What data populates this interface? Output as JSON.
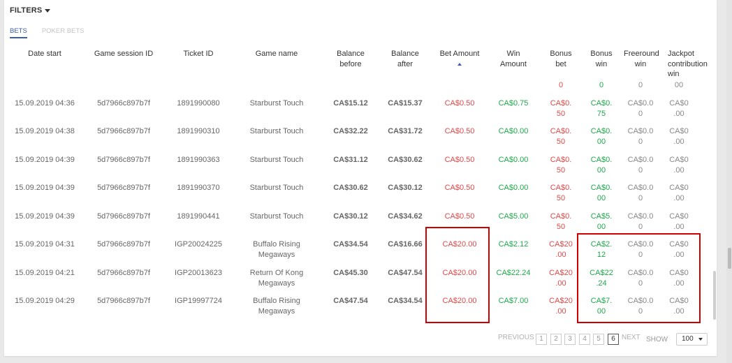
{
  "filters_label": "FILTERS",
  "tabs": [
    {
      "label": "BETS",
      "active": true
    },
    {
      "label": "POKER BETS",
      "active": false
    }
  ],
  "columns": [
    {
      "key": "date",
      "label": "Date start"
    },
    {
      "key": "session",
      "label": "Game session ID"
    },
    {
      "key": "ticket",
      "label": "Ticket ID"
    },
    {
      "key": "game",
      "label": "Game name"
    },
    {
      "key": "bal_before",
      "label": "Balance before"
    },
    {
      "key": "bal_after",
      "label": "Balance after"
    },
    {
      "key": "bet",
      "label": "Bet Amount",
      "sorted": "asc"
    },
    {
      "key": "win",
      "label": "Win Amount"
    },
    {
      "key": "bonus_bet",
      "label": "Bonus bet"
    },
    {
      "key": "bonus_win",
      "label": "Bonus win"
    },
    {
      "key": "freeround",
      "label": "Freeround win"
    },
    {
      "key": "jackpot",
      "label": "Jackpot contribution win"
    }
  ],
  "partial_row": {
    "bonus_bet": "0",
    "bonus_win": "0",
    "freeround": "0",
    "jackpot": "00"
  },
  "rows": [
    {
      "date": "15.09.2019 04:36",
      "session": "5d7966c897b7f",
      "ticket": "1891990080",
      "game": "Starburst Touch",
      "bal_before": "CA$15.12",
      "bal_after": "CA$15.37",
      "bet": "CA$0.50",
      "win": "CA$0.75",
      "bonus_bet": "CA$0.50",
      "bonus_win": "CA$0.75",
      "freeround": "CA$0.00",
      "jackpot": "CA$0.00"
    },
    {
      "date": "15.09.2019 04:38",
      "session": "5d7966c897b7f",
      "ticket": "1891990310",
      "game": "Starburst Touch",
      "bal_before": "CA$32.22",
      "bal_after": "CA$31.72",
      "bet": "CA$0.50",
      "win": "CA$0.00",
      "bonus_bet": "CA$0.50",
      "bonus_win": "CA$0.00",
      "freeround": "CA$0.00",
      "jackpot": "CA$0.00"
    },
    {
      "date": "15.09.2019 04:39",
      "session": "5d7966c897b7f",
      "ticket": "1891990363",
      "game": "Starburst Touch",
      "bal_before": "CA$31.12",
      "bal_after": "CA$30.62",
      "bet": "CA$0.50",
      "win": "CA$0.00",
      "bonus_bet": "CA$0.50",
      "bonus_win": "CA$0.00",
      "freeround": "CA$0.00",
      "jackpot": "CA$0.00"
    },
    {
      "date": "15.09.2019 04:39",
      "session": "5d7966c897b7f",
      "ticket": "1891990370",
      "game": "Starburst Touch",
      "bal_before": "CA$30.62",
      "bal_after": "CA$30.12",
      "bet": "CA$0.50",
      "win": "CA$0.00",
      "bonus_bet": "CA$0.50",
      "bonus_win": "CA$0.00",
      "freeround": "CA$0.00",
      "jackpot": "CA$0.00"
    },
    {
      "date": "15.09.2019 04:39",
      "session": "5d7966c897b7f",
      "ticket": "1891990441",
      "game": "Starburst Touch",
      "bal_before": "CA$30.12",
      "bal_after": "CA$34.62",
      "bet": "CA$0.50",
      "win": "CA$5.00",
      "bonus_bet": "CA$0.50",
      "bonus_win": "CA$5.00",
      "freeround": "CA$0.00",
      "jackpot": "CA$0.00"
    },
    {
      "date": "15.09.2019 04:31",
      "session": "5d7966c897b7f",
      "ticket": "IGP20024225",
      "game": "Buffalo Rising Megaways",
      "bal_before": "CA$34.54",
      "bal_after": "CA$16.66",
      "bet": "CA$20.00",
      "win": "CA$2.12",
      "bonus_bet": "CA$20.00",
      "bonus_win": "CA$2.12",
      "freeround": "CA$0.00",
      "jackpot": "CA$0.00"
    },
    {
      "date": "15.09.2019 04:21",
      "session": "5d7966c897b7f",
      "ticket": "IGP20013623",
      "game": "Return Of Kong Megaways",
      "bal_before": "CA$45.30",
      "bal_after": "CA$47.54",
      "bet": "CA$20.00",
      "win": "CA$22.24",
      "bonus_bet": "CA$20.00",
      "bonus_win": "CA$22.24",
      "freeround": "CA$0.00",
      "jackpot": "CA$0.00"
    },
    {
      "date": "15.09.2019 04:29",
      "session": "5d7966c897b7f",
      "ticket": "IGP19997724",
      "game": "Buffalo Rising Megaways",
      "bal_before": "CA$47.54",
      "bal_after": "CA$34.54",
      "bet": "CA$20.00",
      "win": "CA$7.00",
      "bonus_bet": "CA$20.00",
      "bonus_win": "CA$7.00",
      "freeround": "CA$0.00",
      "jackpot": "CA$0.00"
    }
  ],
  "pagination": {
    "previous_label": "PREVIOUS",
    "pages": [
      "1",
      "2",
      "3",
      "4",
      "5",
      "6"
    ],
    "current": "6",
    "next_label": "NEXT",
    "show_label": "SHOW",
    "page_size": "100"
  },
  "colors": {
    "accent": "#3b5ea8",
    "bet": "#e04848",
    "win": "#1ea84a",
    "highlight": "#d00000"
  },
  "icons": {
    "filters": "caret-down-icon",
    "sort": "sort-asc-icon",
    "select": "caret-down-icon"
  }
}
